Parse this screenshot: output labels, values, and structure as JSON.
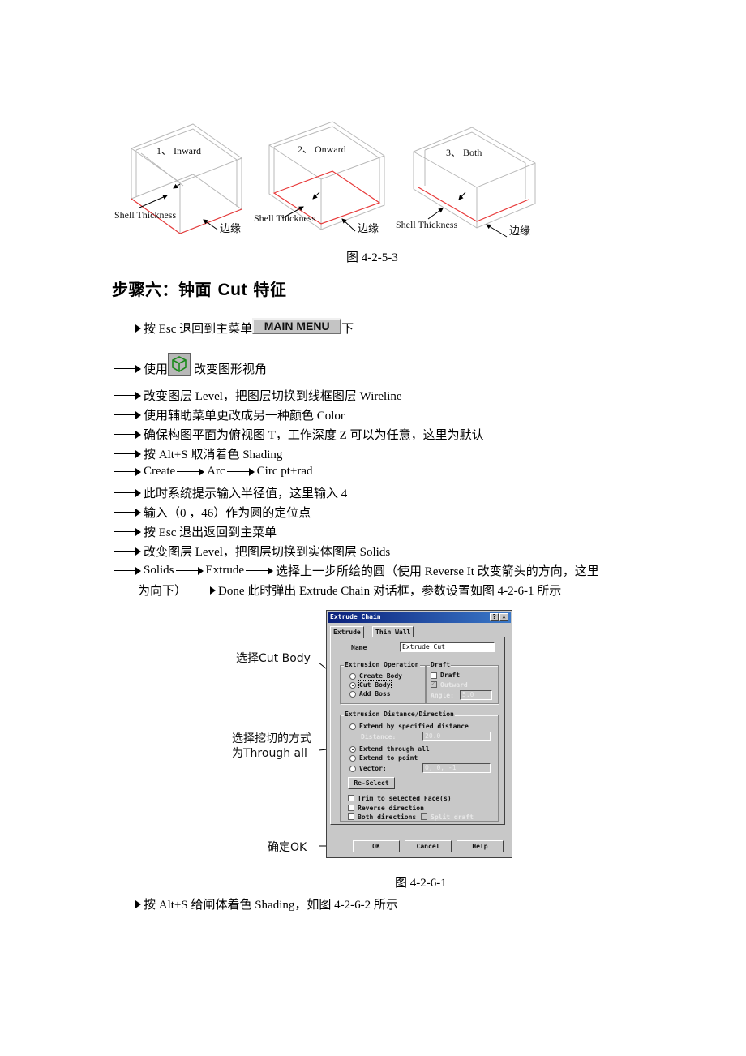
{
  "figure_top": {
    "panels": [
      {
        "label": "1、 Inward",
        "thickness_label": "Shell Thickness",
        "edge_label": "边缘"
      },
      {
        "label": "2、 Onward",
        "thickness_label": "Shell Thickness",
        "edge_label": "边缘"
      },
      {
        "label": "3、 Both",
        "thickness_label": "Shell Thickness",
        "edge_label": "边缘"
      }
    ],
    "caption": "图 4-2-5-3",
    "colors": {
      "edge": "#e83a3a",
      "wire": "#b8b8b8",
      "arrow": "#000000"
    }
  },
  "heading": {
    "prefix": "步骤六：钟面 ",
    "latin": "Cut",
    "suffix": " 特征"
  },
  "steps": [
    {
      "text": "按 Esc 退回到主菜单",
      "button": "MAIN MENU",
      "after": "下"
    },
    {
      "before": "使用",
      "icon": "view-cube-icon",
      "after": " 改变图形视角"
    },
    {
      "text": "改变图层 Level，把图层切换到线框图层 Wireline"
    },
    {
      "text": "使用辅助菜单更改成另一种颜色 Color"
    },
    {
      "text": "确保构图平面为俯视图 T，工作深度 Z 可以为任意，这里为默认"
    },
    {
      "text": "按 Alt+S 取消着色 Shading"
    },
    {
      "parts": [
        "Create",
        "Arc",
        "Circ pt+rad"
      ]
    },
    {
      "text": "此时系统提示输入半径值，这里输入 4"
    },
    {
      "text": "输入（0 ，46）作为圆的定位点"
    },
    {
      "text": "按 Esc 退出返回到主菜单"
    },
    {
      "text": "改变图层 Level，把图层切换到实体图层 Solids"
    },
    {
      "parts": [
        "Solids",
        "Extrude",
        "选择上一步所绘的圆（使用 Reverse It 改变箭头的方向，这里"
      ],
      "continuation_before": "为向下）",
      "continuation_after": "Done  此时弹出 Extrude Chain 对话框，参数设置如图 4-2-6-1 所示"
    },
    {
      "text": "按 Alt+S 给闸体着色 Shading，如图 4-2-6-2 所示"
    }
  ],
  "dialog": {
    "title": "Extrude Chain",
    "help_btn": "?",
    "close_btn": "✕",
    "tabs": [
      "Extrude",
      "Thin Wall"
    ],
    "active_tab": "Extrude",
    "name_label": "Name",
    "name_value": "Extrude Cut",
    "operation_group": "Extrusion Operation",
    "operations": [
      {
        "label": "Create Body",
        "checked": false
      },
      {
        "label": "Cut Body",
        "checked": true
      },
      {
        "label": "Add Boss",
        "checked": false
      }
    ],
    "draft_group": "Draft",
    "draft_checkbox": {
      "label": "Draft",
      "checked": false
    },
    "outward_checkbox": {
      "label": "Outward",
      "checked": true,
      "disabled": true
    },
    "angle_label": "Angle:",
    "angle_value": "5.0",
    "distance_group": "Extrusion Distance/Direction",
    "distance_options": [
      {
        "label": "Extend by specified distance",
        "checked": false
      },
      {
        "label": "Extend through all",
        "checked": true
      },
      {
        "label": "Extend to point",
        "checked": false
      },
      {
        "label": "Vector:",
        "checked": false
      }
    ],
    "distance_label": "Distance:",
    "distance_value": "20.0",
    "vector_value": "0, 0, -1",
    "reselect_btn": "Re-Select",
    "checkboxes": [
      {
        "label": "Trim to selected Face(s)",
        "checked": false
      },
      {
        "label": "Reverse direction",
        "checked": false
      },
      {
        "label": "Both directions",
        "checked": false
      }
    ],
    "split_draft": {
      "label": "Split draft",
      "checked": false,
      "disabled": true
    },
    "ok_btn": "OK",
    "cancel_btn": "Cancel",
    "help_button": "Help"
  },
  "callouts": {
    "cut_body": "选择Cut Body",
    "through_all_1": "选择挖切的方式",
    "through_all_2": "为Through all",
    "ok": "确定OK"
  },
  "caption_dialog": "图 4-2-6-1"
}
